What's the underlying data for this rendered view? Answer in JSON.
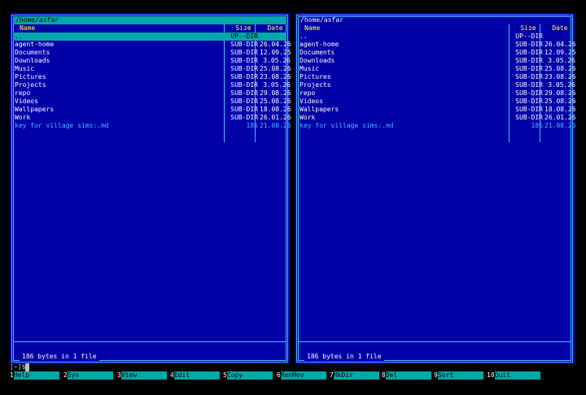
{
  "left_panel": {
    "path": "/home/asfar",
    "header": {
      "name": "Name",
      "size": "Size",
      "date": "Date"
    },
    "rows": [
      {
        "name": "..",
        "size": "UP--DIR",
        "date": ""
      },
      {
        "name": "agent-home",
        "size": "SUB-DIR",
        "date": "26.04.26"
      },
      {
        "name": "Documents",
        "size": "SUB-DIR",
        "date": "12.09.25"
      },
      {
        "name": "Downloads",
        "size": "SUB-DIR",
        "date": "3.05.26"
      },
      {
        "name": "Music",
        "size": "SUB-DIR",
        "date": "25.08.26"
      },
      {
        "name": "Pictures",
        "size": "SUB-DIR",
        "date": "23.08.26"
      },
      {
        "name": "Projects",
        "size": "SUB-DIR",
        "date": "3.05.26"
      },
      {
        "name": "repo",
        "size": "SUB-DIR",
        "date": "29.08.26"
      },
      {
        "name": "Videos",
        "size": "SUB-DIR",
        "date": "25.08.26"
      },
      {
        "name": "Wallpapers",
        "size": "SUB-DIR",
        "date": "18.08.26"
      },
      {
        "name": "Work",
        "size": "SUB-DIR",
        "date": "26.01.26"
      },
      {
        "name": "key for village sims:.md",
        "size": "186",
        "date": "21.08.26"
      }
    ],
    "status": "186 bytes in 1 file"
  },
  "right_panel": {
    "path": "/home/asfar",
    "header": {
      "name": "Name",
      "size": "Size",
      "date": "Date"
    },
    "rows": [
      {
        "name": "..",
        "size": "UP--DIR",
        "date": ""
      },
      {
        "name": "agent-home",
        "size": "SUB-DIR",
        "date": "26.04.26"
      },
      {
        "name": "Documents",
        "size": "SUB-DIR",
        "date": "12.09.25"
      },
      {
        "name": "Downloads",
        "size": "SUB-DIR",
        "date": "3.05.26"
      },
      {
        "name": "Music",
        "size": "SUB-DIR",
        "date": "25.08.26"
      },
      {
        "name": "Pictures",
        "size": "SUB-DIR",
        "date": "23.08.26"
      },
      {
        "name": "Projects",
        "size": "SUB-DIR",
        "date": "3.05.26"
      },
      {
        "name": "repo",
        "size": "SUB-DIR",
        "date": "29.08.26"
      },
      {
        "name": "Videos",
        "size": "SUB-DIR",
        "date": "25.08.26"
      },
      {
        "name": "Wallpapers",
        "size": "SUB-DIR",
        "date": "18.08.26"
      },
      {
        "name": "Work",
        "size": "SUB-DIR",
        "date": "26.01.26"
      },
      {
        "name": "key for village sims:.md",
        "size": "186",
        "date": "21.08.26"
      }
    ],
    "status": "186 bytes in 1 file"
  },
  "command_line": {
    "prompt": "[~]$"
  },
  "function_keys": [
    {
      "num": "1",
      "label": "Help"
    },
    {
      "num": "2",
      "label": "Sys"
    },
    {
      "num": "3",
      "label": "View"
    },
    {
      "num": "4",
      "label": "Edit"
    },
    {
      "num": "5",
      "label": "Copy"
    },
    {
      "num": "6",
      "label": "RenMov"
    },
    {
      "num": "7",
      "label": "MkDir"
    },
    {
      "num": "8",
      "label": "Del"
    },
    {
      "num": "9",
      "label": "Sort"
    },
    {
      "num": "10",
      "label": "Quit"
    }
  ],
  "colors": {
    "panel_bg": "#0000a8",
    "frame": "#4fb8ff",
    "selection": "#00a8a8",
    "header_text": "#ffff55"
  }
}
